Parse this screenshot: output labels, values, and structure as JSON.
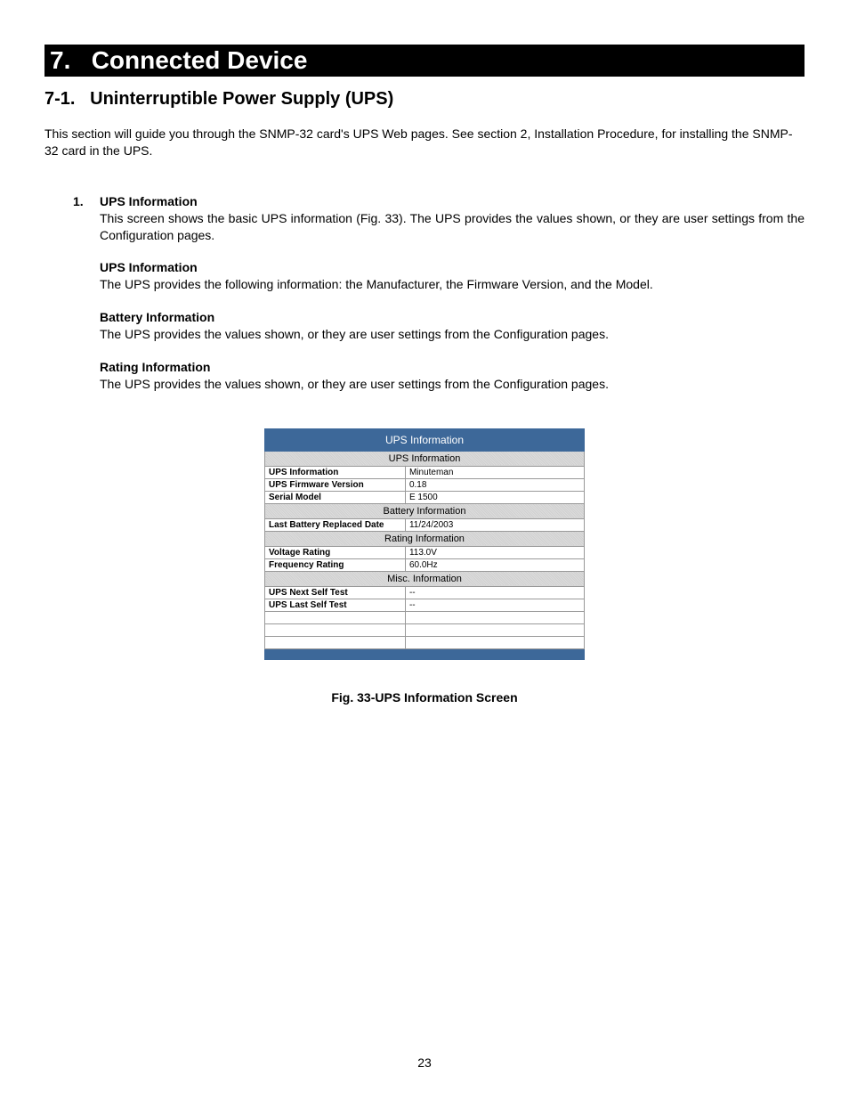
{
  "chapter": {
    "number": "7.",
    "title": "Connected Device"
  },
  "section": {
    "number": "7-1.",
    "title": "Uninterruptible Power Supply (UPS)"
  },
  "intro": "This section will guide you through the SNMP-32 card's UPS Web pages.  See section 2, Installation Procedure, for installing the SNMP-32 card in the UPS.",
  "numbered": {
    "num": "1.",
    "heading": "UPS Information",
    "text": "This screen shows the basic UPS information (Fig. 33).  The UPS provides the values shown, or they are user settings from the Configuration pages.",
    "subs": [
      {
        "head": "UPS Information",
        "body": "The UPS provides the following information:  the Manufacturer, the Firmware Version, and the Model."
      },
      {
        "head": "Battery Information",
        "body": "The UPS provides the values shown, or they are user settings from the Configuration pages."
      },
      {
        "head": "Rating Information",
        "body": "The UPS provides the values shown, or they are user settings from the Configuration pages."
      }
    ]
  },
  "figure": {
    "banner": "UPS Information",
    "groups": [
      {
        "header": "UPS Information",
        "rows": [
          {
            "k": "UPS Information",
            "v": "Minuteman"
          },
          {
            "k": "UPS Firmware Version",
            "v": "0.18"
          },
          {
            "k": "Serial Model",
            "v": "E 1500"
          }
        ]
      },
      {
        "header": "Battery Information",
        "rows": [
          {
            "k": "Last Battery Replaced Date",
            "v": "11/24/2003"
          }
        ]
      },
      {
        "header": "Rating Information",
        "rows": [
          {
            "k": "Voltage Rating",
            "v": "113.0V"
          },
          {
            "k": "Frequency Rating",
            "v": "60.0Hz"
          }
        ]
      },
      {
        "header": "Misc. Information",
        "rows": [
          {
            "k": "UPS Next Self Test",
            "v": "--"
          },
          {
            "k": "UPS Last Self Test",
            "v": "--"
          },
          {
            "k": "",
            "v": ""
          },
          {
            "k": "",
            "v": ""
          },
          {
            "k": "",
            "v": ""
          }
        ]
      }
    ],
    "caption": "Fig. 33-UPS Information Screen"
  },
  "pageNumber": "23"
}
